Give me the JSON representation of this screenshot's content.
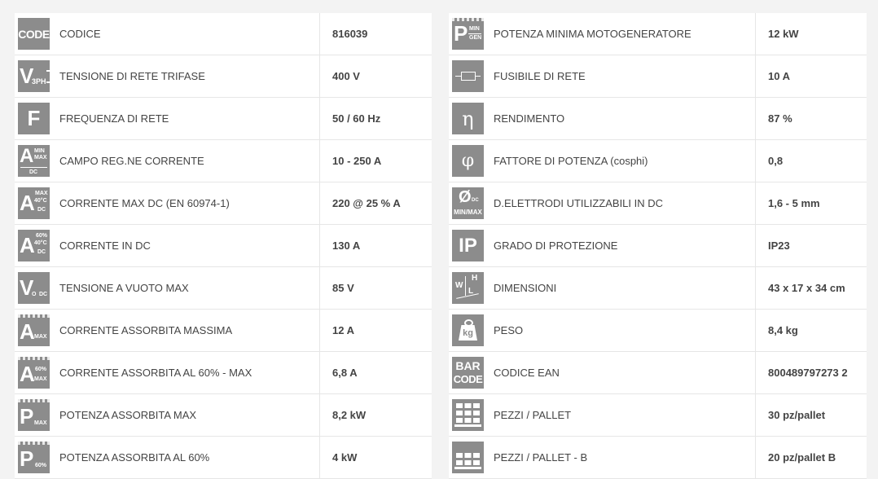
{
  "left": [
    {
      "icon": "code-icon",
      "label": "CODICE",
      "value": "816039"
    },
    {
      "icon": "voltage-3ph-icon",
      "label": "TENSIONE DI RETE TRIFASE",
      "value": "400 V"
    },
    {
      "icon": "frequency-icon",
      "label": "FREQUENZA DI RETE",
      "value": "50 / 60 Hz"
    },
    {
      "icon": "current-range-icon",
      "label": "CAMPO REG.NE CORRENTE",
      "value": "10 - 250 A"
    },
    {
      "icon": "current-max-dc-icon",
      "label": "CORRENTE MAX DC (EN 60974-1)",
      "value": "220 @ 25 % A"
    },
    {
      "icon": "current-dc-icon",
      "label": "CORRENTE IN DC",
      "value": "130 A"
    },
    {
      "icon": "open-voltage-icon",
      "label": "TENSIONE A VUOTO MAX",
      "value": "85 V"
    },
    {
      "icon": "absorbed-current-max-icon",
      "label": "CORRENTE ASSORBITA MASSIMA",
      "value": "12 A"
    },
    {
      "icon": "absorbed-current-60-icon",
      "label": "CORRENTE ASSORBITA AL 60% - MAX",
      "value": "6,8 A"
    },
    {
      "icon": "absorbed-power-max-icon",
      "label": "POTENZA ASSORBITA MAX",
      "value": "8,2 kW"
    },
    {
      "icon": "absorbed-power-60-icon",
      "label": "POTENZA ASSORBITA AL 60%",
      "value": "4 kW"
    }
  ],
  "right": [
    {
      "icon": "generator-power-icon",
      "label": "POTENZA MINIMA MOTOGENERATORE",
      "value": "12 kW"
    },
    {
      "icon": "fuse-icon",
      "label": "FUSIBILE DI RETE",
      "value": "10 A"
    },
    {
      "icon": "efficiency-icon",
      "label": "RENDIMENTO",
      "value": "87 %"
    },
    {
      "icon": "power-factor-icon",
      "label": "FATTORE DI POTENZA (cosphi)",
      "value": "0,8"
    },
    {
      "icon": "electrode-diameter-icon",
      "label": "D.ELETTRODI UTILIZZABILI IN DC",
      "value": "1,6 - 5 mm"
    },
    {
      "icon": "ip-rating-icon",
      "label": "GRADO DI PROTEZIONE",
      "value": "IP23"
    },
    {
      "icon": "dimensions-icon",
      "label": "DIMENSIONI",
      "value": "43 x 17 x 34 cm"
    },
    {
      "icon": "weight-icon",
      "label": "PESO",
      "value": "8,4 kg"
    },
    {
      "icon": "barcode-icon",
      "label": "CODICE EAN",
      "value": "800489797273 2"
    },
    {
      "icon": "pallet-icon",
      "label": "PEZZI / PALLET",
      "value": "30 pz/pallet"
    },
    {
      "icon": "pallet-b-icon",
      "label": "PEZZI / PALLET - B",
      "value": "20 pz/pallet B"
    }
  ],
  "icon_text": {
    "code": "CODE",
    "v": "V",
    "v3ph": "3PH",
    "f": "F",
    "a": "A",
    "min": "MIN",
    "max": "MAX",
    "dc": "DC",
    "deg40": "40°C",
    "pct60": "60%",
    "o": "O",
    "p": "P",
    "gen": "GEN",
    "eta": "η",
    "phi": "φ",
    "dia": "Ø",
    "minmax": "MIN/MAX",
    "ip": "IP",
    "w": "W",
    "h": "H",
    "l": "L",
    "kg": "kg",
    "bar": "BAR",
    "codeb": "CODE"
  },
  "colors": {
    "icon_bg": "#8c8c8c",
    "row_bg": "#ffffff",
    "page_bg": "#f3f3f3",
    "text": "#444444",
    "border": "#e6e6e6"
  }
}
